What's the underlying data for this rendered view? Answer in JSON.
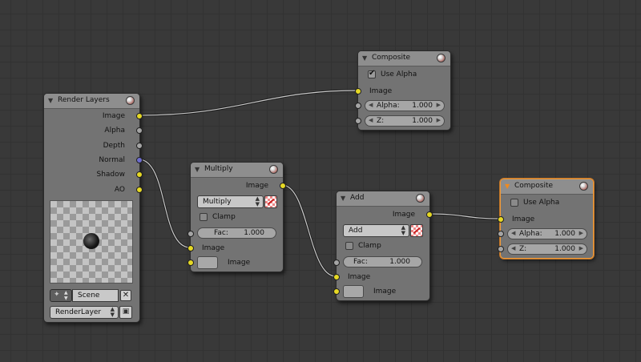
{
  "nodes": {
    "composite_top": {
      "title": "Composite",
      "use_alpha_label": "Use Alpha",
      "use_alpha_checked": true,
      "image_label": "Image",
      "alpha": {
        "label": "Alpha:",
        "value": "1.000"
      },
      "z": {
        "label": "Z:",
        "value": "1.000"
      }
    },
    "render_layers": {
      "title": "Render Layers",
      "outputs": [
        "Image",
        "Alpha",
        "Depth",
        "Normal",
        "Shadow",
        "AO"
      ],
      "scene": "Scene",
      "layer": "RenderLayer"
    },
    "multiply": {
      "title": "Multiply",
      "output_label": "Image",
      "blend_mode": "Multiply",
      "clamp_label": "Clamp",
      "fac": {
        "label": "Fac:",
        "value": "1.000"
      },
      "input1_label": "Image",
      "input2_label": "Image"
    },
    "add": {
      "title": "Add",
      "output_label": "Image",
      "blend_mode": "Add",
      "clamp_label": "Clamp",
      "fac": {
        "label": "Fac:",
        "value": "1.000"
      },
      "input1_label": "Image",
      "input2_label": "Image"
    },
    "composite_right": {
      "title": "Composite",
      "use_alpha_label": "Use Alpha",
      "use_alpha_checked": false,
      "image_label": "Image",
      "alpha": {
        "label": "Alpha:",
        "value": "1.000"
      },
      "z": {
        "label": "Z:",
        "value": "1.000"
      }
    }
  },
  "colors": {
    "background": "#393939",
    "node_body": "#737373",
    "node_header": "#8e8e8e",
    "socket_color": "#e6d925",
    "socket_value": "#a5a5a5",
    "socket_vector": "#6e6ecf",
    "selected_outline": "#ef9a3a"
  }
}
